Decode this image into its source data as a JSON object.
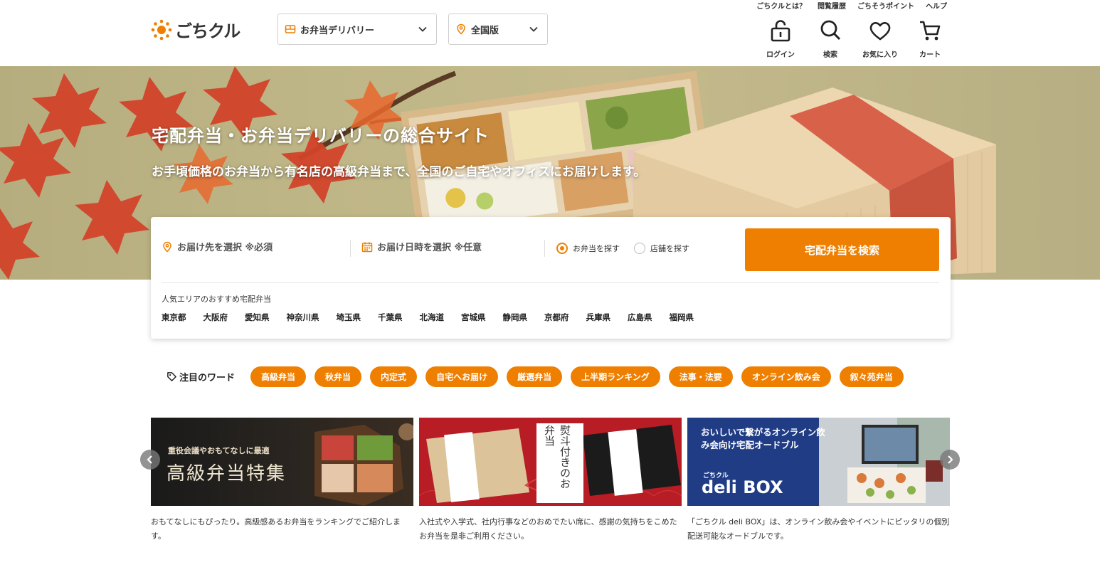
{
  "header": {
    "logo_text": "ごちクル",
    "service_select": "お弁当デリバリー",
    "region_select": "全国版",
    "top_links": [
      "ごちクルとは？",
      "閲覧履歴",
      "ごちそうポイント",
      "ヘルプ"
    ],
    "icons": [
      {
        "label": "ログイン",
        "icon": "login-icon"
      },
      {
        "label": "検索",
        "icon": "search-icon"
      },
      {
        "label": "お気に入り",
        "icon": "heart-icon"
      },
      {
        "label": "カート",
        "icon": "cart-icon"
      }
    ]
  },
  "hero": {
    "title": "宅配弁当・お弁当デリバリーの総合サイト",
    "subtitle": "お手頃価格のお弁当から有名店の高級弁当まで、全国のご自宅やオフィスにお届けします。"
  },
  "search": {
    "destination": "お届け先を選択 ※必須",
    "datetime": "お届け日時を選択 ※任意",
    "radio_bento": "お弁当を探す",
    "radio_shop": "店舗を探す",
    "button": "宅配弁当を検索",
    "popular_label": "人気エリアのおすすめ宅配弁当",
    "popular_areas": [
      "東京都",
      "大阪府",
      "愛知県",
      "神奈川県",
      "埼玉県",
      "千葉県",
      "北海道",
      "宮城県",
      "静岡県",
      "京都府",
      "兵庫県",
      "広島県",
      "福岡県"
    ]
  },
  "keywords": {
    "label": "注目のワード",
    "items": [
      "高級弁当",
      "秋弁当",
      "内定式",
      "自宅へお届け",
      "厳選弁当",
      "上半期ランキング",
      "法事・法要",
      "オンライン飲み会",
      "叙々苑弁当"
    ]
  },
  "banners": [
    {
      "small": "重役会議やおもてなしに最適",
      "big": "高級弁当特集",
      "caption": "おもてなしにもぴったり。高級感あるお弁当をランキングでご紹介します。"
    },
    {
      "vertical": "熨斗付きのお弁当",
      "caption": "入社式や入学式、社内行事などのおめでたい席に、感謝の気持ちをこめたお弁当を是非ご利用ください。"
    },
    {
      "text": "おいしいで繋がるオンライン飲み会向け宅配オードブル",
      "logo_small": "ごちクル",
      "logo_big": "deli BOX",
      "caption": "「ごちクル deli BOX」は、オンライン飲み会やイベントにピッタリの個別配送可能なオードブルです。"
    }
  ],
  "colors": {
    "accent": "#ee7f00"
  }
}
